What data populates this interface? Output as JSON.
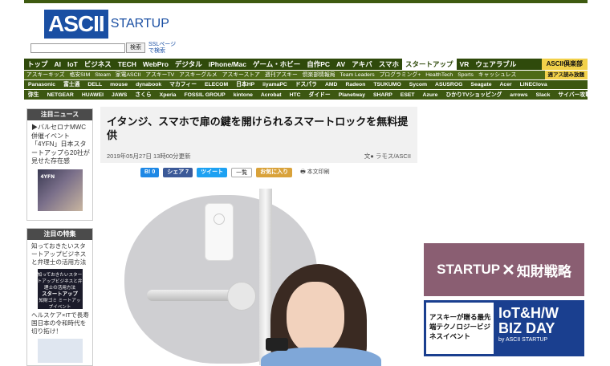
{
  "header": {
    "logo_main": "ASCII",
    "logo_sub": "STARTUP",
    "search_button": "検索",
    "ssl_line1": "SSLページ",
    "ssl_line2": "で検索"
  },
  "nav_main": [
    "トップ",
    "AI",
    "IoT",
    "ビジネス",
    "TECH",
    "WebPro",
    "デジタル",
    "iPhone/Mac",
    "ゲーム・ホビー",
    "自作PC",
    "AV",
    "アキバ",
    "スマホ",
    "スタートアップ",
    "VR",
    "ウェアラブル"
  ],
  "nav_main_active": "スタートアップ",
  "nav_club": "ASCII倶楽部",
  "nav_sub": [
    "アスキーキッズ",
    "格安SIM",
    "Steam",
    "家電ASCII",
    "アスキーTV",
    "アスキーグルメ",
    "アスキーストア",
    "週刊アスキー",
    "倶楽部情報局",
    "Team Leaders",
    "プログラミング+",
    "HealthTech",
    "Sports",
    "キャッシュレス"
  ],
  "nav_sub_badge": "週アス読み放題",
  "nav_brands_1": [
    "Panasonic",
    "富士通",
    "DELL",
    "mouse",
    "dynabook",
    "マカフィー",
    "ELECOM",
    "日本HP",
    "iiyamaPC",
    "ドスパラ",
    "AMD",
    "Radeon",
    "TSUKUMO",
    "Sycom",
    "ASUSROG",
    "Seagate",
    "Acer",
    "LINEClova"
  ],
  "nav_brands_2": [
    "弥生",
    "NETGEAR",
    "HUAWEI",
    "JAWS",
    "さくら",
    "Xperia",
    "FOSSIL GROUP",
    "kintone",
    "Acrobat",
    "HTC",
    "ダイドー",
    "Planetway",
    "SHARP",
    "ESET",
    "Azure",
    "ひかりTVショッピング",
    "arrows",
    "Slack",
    "サイバー攻撃コンテスト"
  ],
  "sidebar": {
    "news_heading": "注目ニュース",
    "news_text": "▶バルセロナMWC併催イベント「4YFN」日本スタートアップら20社が見せた存在感",
    "news_thumb_label": "4YFN",
    "feature_heading": "注目の特集",
    "feature_1_text": "知っておきたいスタートアップビジネスと弁理士の活用方法",
    "feature_1_thumb_small": "知っておきたいスタートアップビジネスと弁理士の活用方法",
    "feature_1_thumb_title": "スタートアップ",
    "feature_1_thumb_sub": "知財ゴミ ミートアップイベント",
    "feature_2_text": "ヘルスケア×ITで長寿国日本の令和時代を切り拓け！"
  },
  "article": {
    "title": "イタンジ、スマホで扉の鍵を開けられるスマートロックを無料提供",
    "date": "2019年05月27日 13時00分更新",
    "byline": "文● ラモス/ASCII",
    "share": {
      "hatena": "B! 0",
      "facebook": "シェア 7",
      "twitter": "ツイート",
      "ichiran": "一覧",
      "favorite": "お気に入り",
      "print": "本文印刷"
    }
  },
  "banners": {
    "startup_left": "STARTUP",
    "startup_x": "✕",
    "startup_right": "知財戦略",
    "iot_left": "アスキーが贈る最先端テクノロジービジネスイベント",
    "iot_big_1": "IoT&H/W",
    "iot_big_2": "BIZ DAY",
    "iot_small": "by ASCII STARTUP"
  },
  "colors": {
    "nav_dark_green": "#2f4a0b",
    "nav_green": "#4e6a17",
    "brand_blue": "#1a4fa3",
    "club_yellow": "#f2d14a"
  }
}
